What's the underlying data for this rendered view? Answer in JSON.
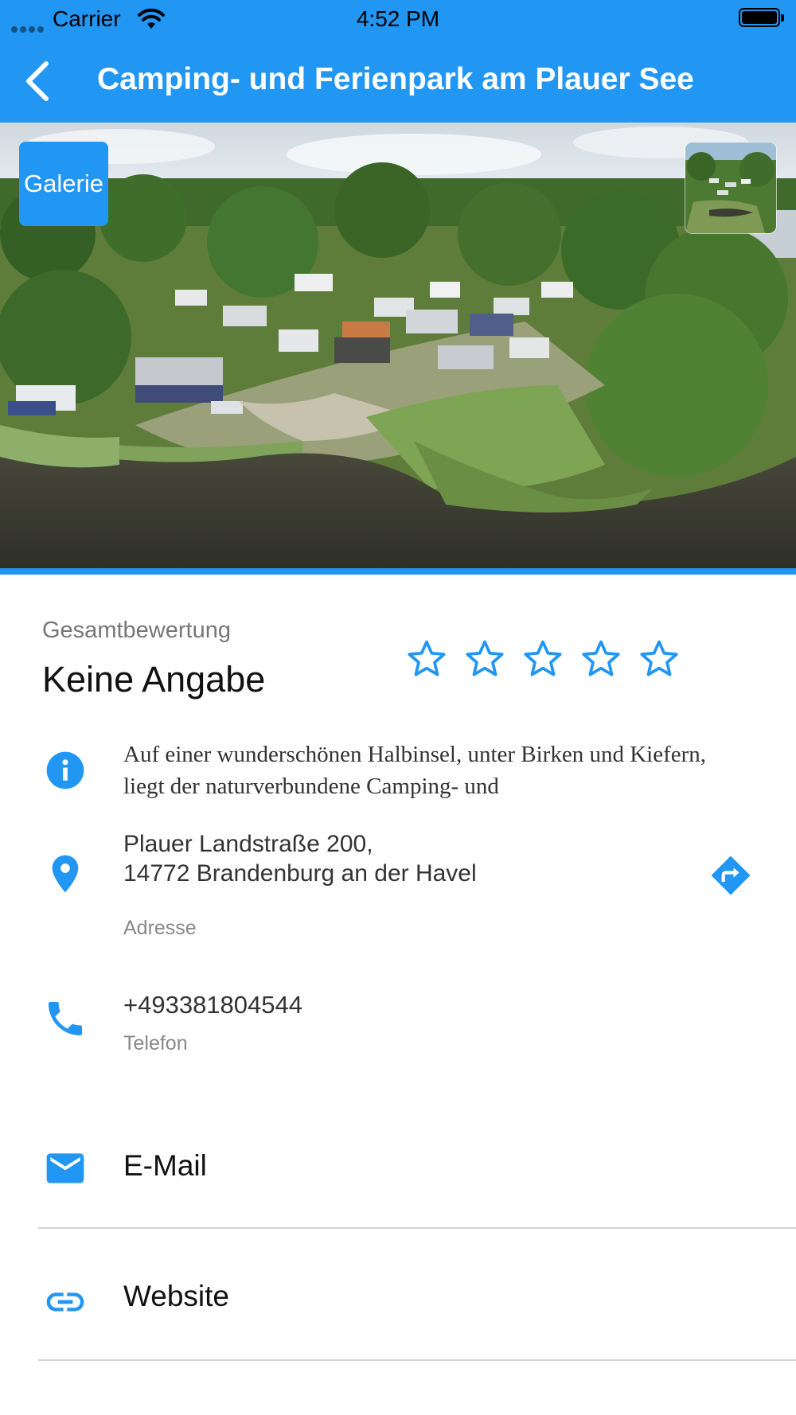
{
  "status_bar": {
    "carrier": "Carrier",
    "time": "4:52 PM"
  },
  "app_bar": {
    "title": "Camping- und Ferienpark am Plauer See",
    "back_icon": "chevron-left-icon"
  },
  "hero": {
    "gallery_button": "Galerie",
    "photo": "aerial view of campground on lake peninsula"
  },
  "rating": {
    "label": "Gesamtbewertung",
    "value": "Keine Angabe",
    "stars_filled": 0,
    "stars_total": 5
  },
  "description": {
    "icon": "info-icon",
    "text": "Auf einer wunderschönen Halbinsel, unter Birken und Kiefern, liegt der naturverbundene Camping- und"
  },
  "address": {
    "icon": "location-pin-icon",
    "line1": "Plauer Landstraße 200,",
    "line2": "14772 Brandenburg an der Havel",
    "label": "Adresse",
    "action_icon": "directions-icon"
  },
  "phone": {
    "icon": "phone-icon",
    "number": "+493381804544",
    "label": "Telefon"
  },
  "links": [
    {
      "icon": "mail-icon",
      "label": "E-Mail"
    },
    {
      "icon": "link-icon",
      "label": "Website"
    }
  ],
  "colors": {
    "primary": "#2196F3",
    "text": "#222222",
    "muted": "#888888"
  }
}
